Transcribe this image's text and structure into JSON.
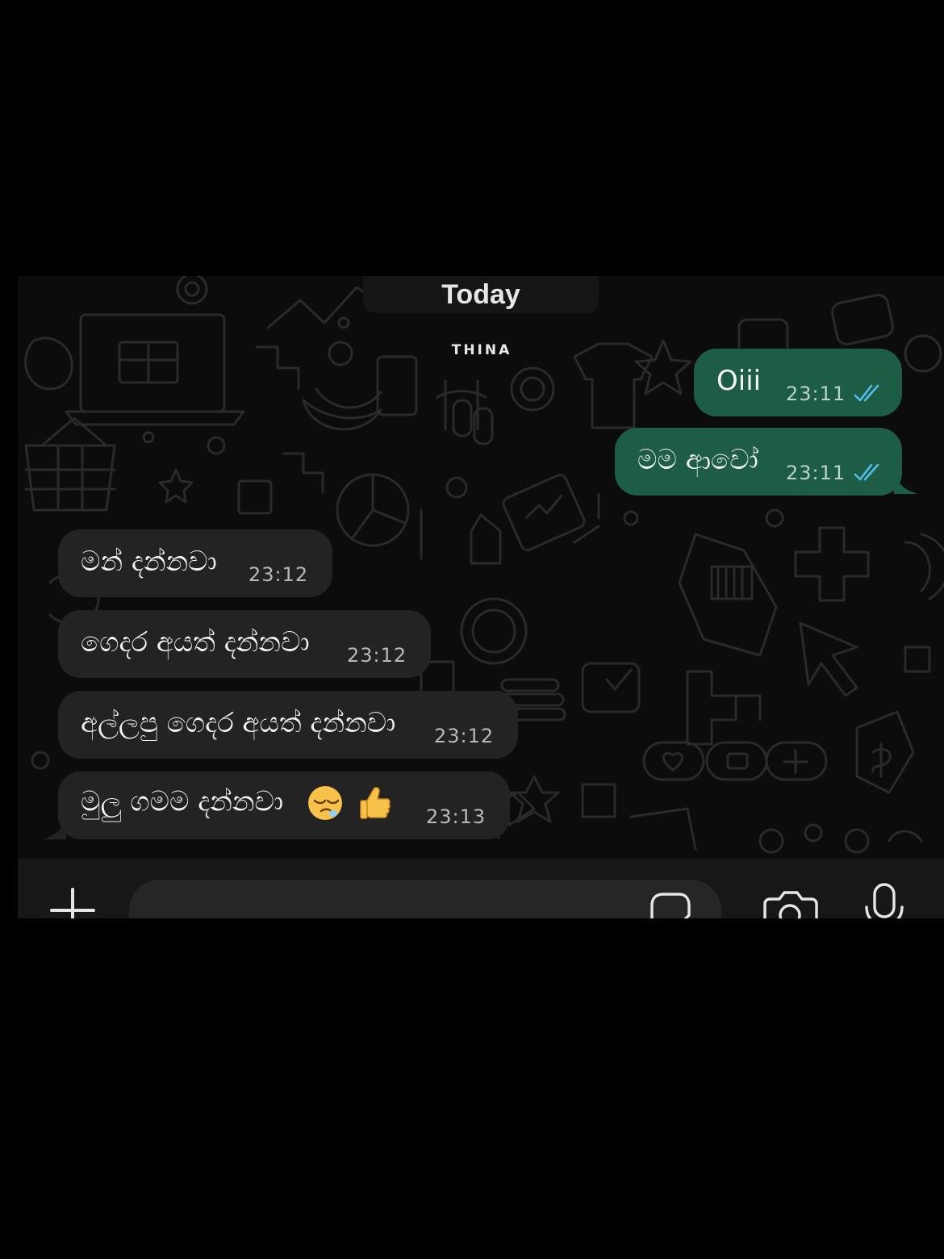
{
  "chat": {
    "date_label": "Today",
    "watermark": "THINA"
  },
  "messages": [
    {
      "direction": "outgoing",
      "text": "Oiii",
      "time": "23:11",
      "status": "read",
      "status_icon": "double-check-icon"
    },
    {
      "direction": "outgoing",
      "text": "මම ආවෝ",
      "time": "23:11",
      "status": "read",
      "status_icon": "double-check-icon"
    },
    {
      "direction": "incoming",
      "text": "මන් දන්නවා",
      "time": "23:12"
    },
    {
      "direction": "incoming",
      "text": "ගෙදර අයත් දන්නවා",
      "time": "23:12"
    },
    {
      "direction": "incoming",
      "text": "අල්ලපු ගෙදර අයත් දන්නවා",
      "time": "23:12"
    },
    {
      "direction": "incoming",
      "text": "මුලු ගමම දන්නවා",
      "time": "23:13",
      "emojis": [
        "sleepy-face",
        "thumbs-up"
      ]
    }
  ],
  "input_bar": {
    "icons": [
      "plus-icon",
      "sticker-icon",
      "camera-icon",
      "microphone-icon"
    ]
  },
  "colors": {
    "background": "#000000",
    "chat_background": "#0c0c0c",
    "outgoing_bubble": "#1d5d45",
    "incoming_bubble": "#232323",
    "read_tick": "#53bdeb",
    "text": "#f2f2f2"
  }
}
